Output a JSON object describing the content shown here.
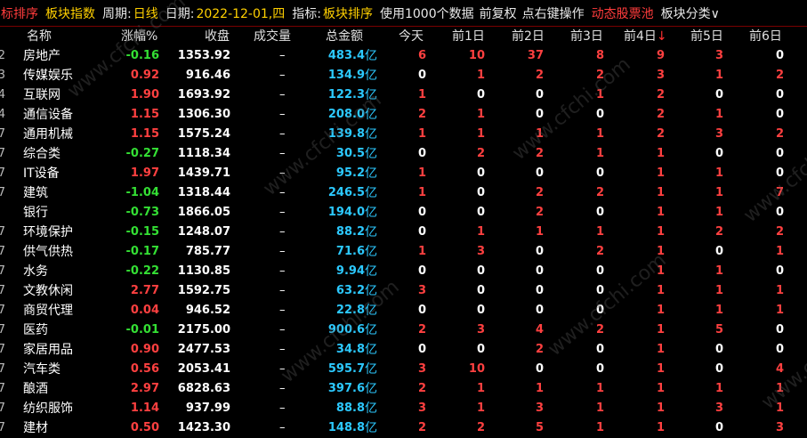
{
  "topbar": {
    "tab1": "标排序",
    "tab2": "板块指数",
    "period_label": "周期:",
    "period_value": "日线",
    "date_label": "日期:",
    "date_value": "2022-12-01,四",
    "indicator_label": "指标:",
    "indicator_value": "板块排序",
    "info": "使用1000个数据",
    "adjust": "前复权",
    "hint": "点右键操作",
    "dynamic_pool": "动态股票池",
    "category": "板块分类∨"
  },
  "columns": {
    "name": "名称",
    "change": "涨幅%",
    "close": "收盘",
    "volume": "成交量",
    "amount": "总金额",
    "today": "今天",
    "d1": "前1日",
    "d2": "前2日",
    "d3": "前3日",
    "d4": "前4日",
    "d4_arrow": "↓",
    "d5": "前5日",
    "d6": "前6日"
  },
  "watermark": "www.cfchi.com",
  "rows": [
    {
      "idx": "2",
      "name": "房地产",
      "chg": "-0.16",
      "close": "1353.92",
      "vol": "–",
      "amt": "483.4",
      "unit": "亿",
      "d": [
        "6",
        "10",
        "37",
        "8",
        "9",
        "3",
        "0"
      ]
    },
    {
      "idx": "3",
      "name": "传媒娱乐",
      "chg": "0.92",
      "close": "916.46",
      "vol": "–",
      "amt": "134.9",
      "unit": "亿",
      "d": [
        "0",
        "1",
        "2",
        "2",
        "3",
        "1",
        "2"
      ]
    },
    {
      "idx": "4",
      "name": "互联网",
      "chg": "1.90",
      "close": "1693.92",
      "vol": "–",
      "amt": "122.3",
      "unit": "亿",
      "d": [
        "1",
        "0",
        "0",
        "1",
        "2",
        "0",
        "0"
      ]
    },
    {
      "idx": "4",
      "name": "通信设备",
      "chg": "1.15",
      "close": "1306.30",
      "vol": "–",
      "amt": "208.0",
      "unit": "亿",
      "d": [
        "2",
        "1",
        "0",
        "0",
        "2",
        "1",
        "0"
      ]
    },
    {
      "idx": "7",
      "name": "通用机械",
      "chg": "1.15",
      "close": "1575.24",
      "vol": "–",
      "amt": "139.8",
      "unit": "亿",
      "d": [
        "1",
        "1",
        "1",
        "1",
        "2",
        "3",
        "2"
      ]
    },
    {
      "idx": "7",
      "name": "综合类",
      "chg": "-0.27",
      "close": "1118.34",
      "vol": "–",
      "amt": "30.5",
      "unit": "亿",
      "d": [
        "0",
        "2",
        "2",
        "1",
        "1",
        "0",
        "0"
      ]
    },
    {
      "idx": "7",
      "name": "IT设备",
      "chg": "1.97",
      "close": "1439.71",
      "vol": "–",
      "amt": "95.2",
      "unit": "亿",
      "d": [
        "1",
        "0",
        "0",
        "0",
        "1",
        "1",
        "0"
      ]
    },
    {
      "idx": "7",
      "name": "建筑",
      "chg": "-1.04",
      "close": "1318.44",
      "vol": "–",
      "amt": "246.5",
      "unit": "亿",
      "d": [
        "1",
        "0",
        "2",
        "2",
        "1",
        "1",
        "7"
      ]
    },
    {
      "idx": "",
      "name": "银行",
      "chg": "-0.73",
      "close": "1866.05",
      "vol": "–",
      "amt": "194.0",
      "unit": "亿",
      "d": [
        "0",
        "0",
        "2",
        "0",
        "1",
        "1",
        "0"
      ]
    },
    {
      "idx": "7",
      "name": "环境保护",
      "chg": "-0.15",
      "close": "1248.07",
      "vol": "–",
      "amt": "88.2",
      "unit": "亿",
      "d": [
        "0",
        "1",
        "1",
        "1",
        "1",
        "2",
        "2"
      ]
    },
    {
      "idx": "7",
      "name": "供气供热",
      "chg": "-0.17",
      "close": "785.77",
      "vol": "–",
      "amt": "71.6",
      "unit": "亿",
      "d": [
        "1",
        "3",
        "0",
        "2",
        "1",
        "0",
        "1"
      ]
    },
    {
      "idx": "7",
      "name": "水务",
      "chg": "-0.22",
      "close": "1130.85",
      "vol": "–",
      "amt": "9.94",
      "unit": "亿",
      "d": [
        "0",
        "0",
        "0",
        "0",
        "1",
        "1",
        "0"
      ]
    },
    {
      "idx": "7",
      "name": "文教休闲",
      "chg": "2.77",
      "close": "1592.75",
      "vol": "–",
      "amt": "63.2",
      "unit": "亿",
      "d": [
        "3",
        "0",
        "0",
        "0",
        "1",
        "1",
        "1"
      ]
    },
    {
      "idx": "7",
      "name": "商贸代理",
      "chg": "0.04",
      "close": "946.52",
      "vol": "–",
      "amt": "22.8",
      "unit": "亿",
      "d": [
        "0",
        "0",
        "0",
        "0",
        "1",
        "1",
        "1"
      ]
    },
    {
      "idx": "7",
      "name": "医药",
      "chg": "-0.01",
      "close": "2175.00",
      "vol": "–",
      "amt": "900.6",
      "unit": "亿",
      "d": [
        "2",
        "3",
        "4",
        "2",
        "1",
        "5",
        "0"
      ]
    },
    {
      "idx": "7",
      "name": "家居用品",
      "chg": "0.90",
      "close": "2477.53",
      "vol": "–",
      "amt": "34.8",
      "unit": "亿",
      "d": [
        "0",
        "0",
        "2",
        "0",
        "1",
        "0",
        "0"
      ]
    },
    {
      "idx": "7",
      "name": "汽车类",
      "chg": "0.56",
      "close": "2053.41",
      "vol": "–",
      "amt": "595.7",
      "unit": "亿",
      "d": [
        "3",
        "10",
        "0",
        "0",
        "1",
        "0",
        "4"
      ]
    },
    {
      "idx": "7",
      "name": "酿酒",
      "chg": "2.97",
      "close": "6828.63",
      "vol": "–",
      "amt": "397.6",
      "unit": "亿",
      "d": [
        "2",
        "1",
        "1",
        "1",
        "1",
        "1",
        "1"
      ]
    },
    {
      "idx": "7",
      "name": "纺织服饰",
      "chg": "1.14",
      "close": "937.99",
      "vol": "–",
      "amt": "88.8",
      "unit": "亿",
      "d": [
        "3",
        "1",
        "3",
        "1",
        "1",
        "3",
        "1"
      ]
    },
    {
      "idx": "7",
      "name": "建材",
      "chg": "0.50",
      "close": "1423.30",
      "vol": "–",
      "amt": "148.8",
      "unit": "亿",
      "d": [
        "2",
        "2",
        "5",
        "1",
        "1",
        "0",
        "3"
      ]
    }
  ],
  "colors": {
    "up": "#ff4040",
    "down": "#34e034",
    "amount": "#2cc9ff",
    "header_accent": "#ffd000"
  }
}
